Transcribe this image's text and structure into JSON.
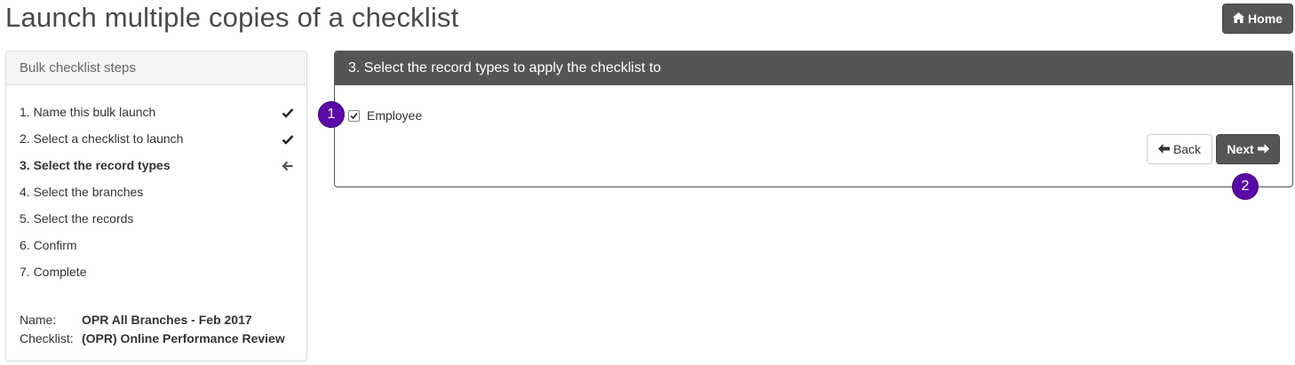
{
  "page": {
    "title": "Launch multiple copies of a checklist"
  },
  "header": {
    "home_label": "Home"
  },
  "sidebar": {
    "title": "Bulk checklist steps",
    "steps": [
      {
        "label": "1. Name this bulk launch",
        "status": "done",
        "icon": "check-icon"
      },
      {
        "label": "2. Select a checklist to launch",
        "status": "done",
        "icon": "check-icon"
      },
      {
        "label": "3. Select the record types",
        "status": "current",
        "icon": "arrow-left-icon"
      },
      {
        "label": "4. Select the branches",
        "status": "pending"
      },
      {
        "label": "5. Select the records",
        "status": "pending"
      },
      {
        "label": "6. Confirm",
        "status": "pending"
      },
      {
        "label": "7. Complete",
        "status": "pending"
      }
    ],
    "name_label": "Name:",
    "name_value": "OPR All Branches - Feb 2017",
    "checklist_label": "Checklist:",
    "checklist_value": "(OPR) Online Performance Review"
  },
  "main": {
    "title": "3. Select the record types to apply the checklist to",
    "record_types": [
      {
        "label": "Employee",
        "checked": true
      }
    ],
    "back_label": "Back",
    "next_label": "Next"
  },
  "annotations": [
    {
      "number": "1"
    },
    {
      "number": "2"
    }
  ],
  "colors": {
    "dark": "#555555",
    "badge": "#5b0aa8"
  }
}
